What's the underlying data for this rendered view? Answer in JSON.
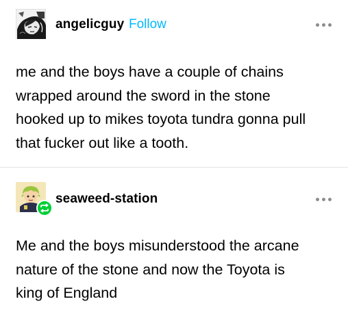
{
  "posts": [
    {
      "username": "angelicguy",
      "follow_label": "Follow",
      "avatar_icon": "manga-portrait-avatar",
      "more_icon": "more-options-icon",
      "body": "me and the boys have a couple of chains\nwrapped around the sword in the stone\nhooked up to mikes toyota tundra gonna pull\nthat fucker out like a tooth."
    },
    {
      "username": "seaweed-station",
      "avatar_icon": "cartoon-character-avatar",
      "badge_icon": "reblog-icon",
      "more_icon": "more-options-icon",
      "body": "Me and the boys misunderstood the arcane\nnature of the stone and now the Toyota is\nking of England"
    }
  ],
  "colors": {
    "follow_link": "#00b8ff",
    "reblog_badge": "#00cf35",
    "divider": "#e6e6e6",
    "more_dots": "#8c8c8c"
  }
}
